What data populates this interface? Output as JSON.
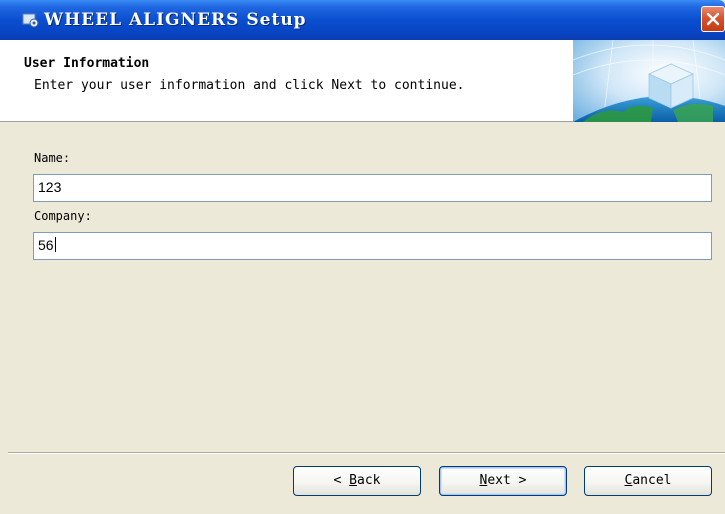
{
  "window": {
    "title": "WHEEL ALIGNERS Setup"
  },
  "icons": {
    "app": "installer-icon",
    "close": "close-icon",
    "banner": "globe-cube-graphic"
  },
  "banner": {
    "title": "User Information",
    "subtitle": "Enter your user information and click Next to continue."
  },
  "form": {
    "name_label": "Name:",
    "name_value": "123",
    "company_label": "Company:",
    "company_value": "56"
  },
  "buttons": {
    "back": {
      "accel": "B",
      "rest": "ack",
      "prefix": "< "
    },
    "next": {
      "accel": "N",
      "rest": "ext >"
    },
    "cancel": {
      "accel": "C",
      "rest": "ancel"
    }
  },
  "colors": {
    "titlebar": "#0a4fd0",
    "close": "#d9532f",
    "dialog": "#ece9d8",
    "field_border": "#7f9db9"
  }
}
